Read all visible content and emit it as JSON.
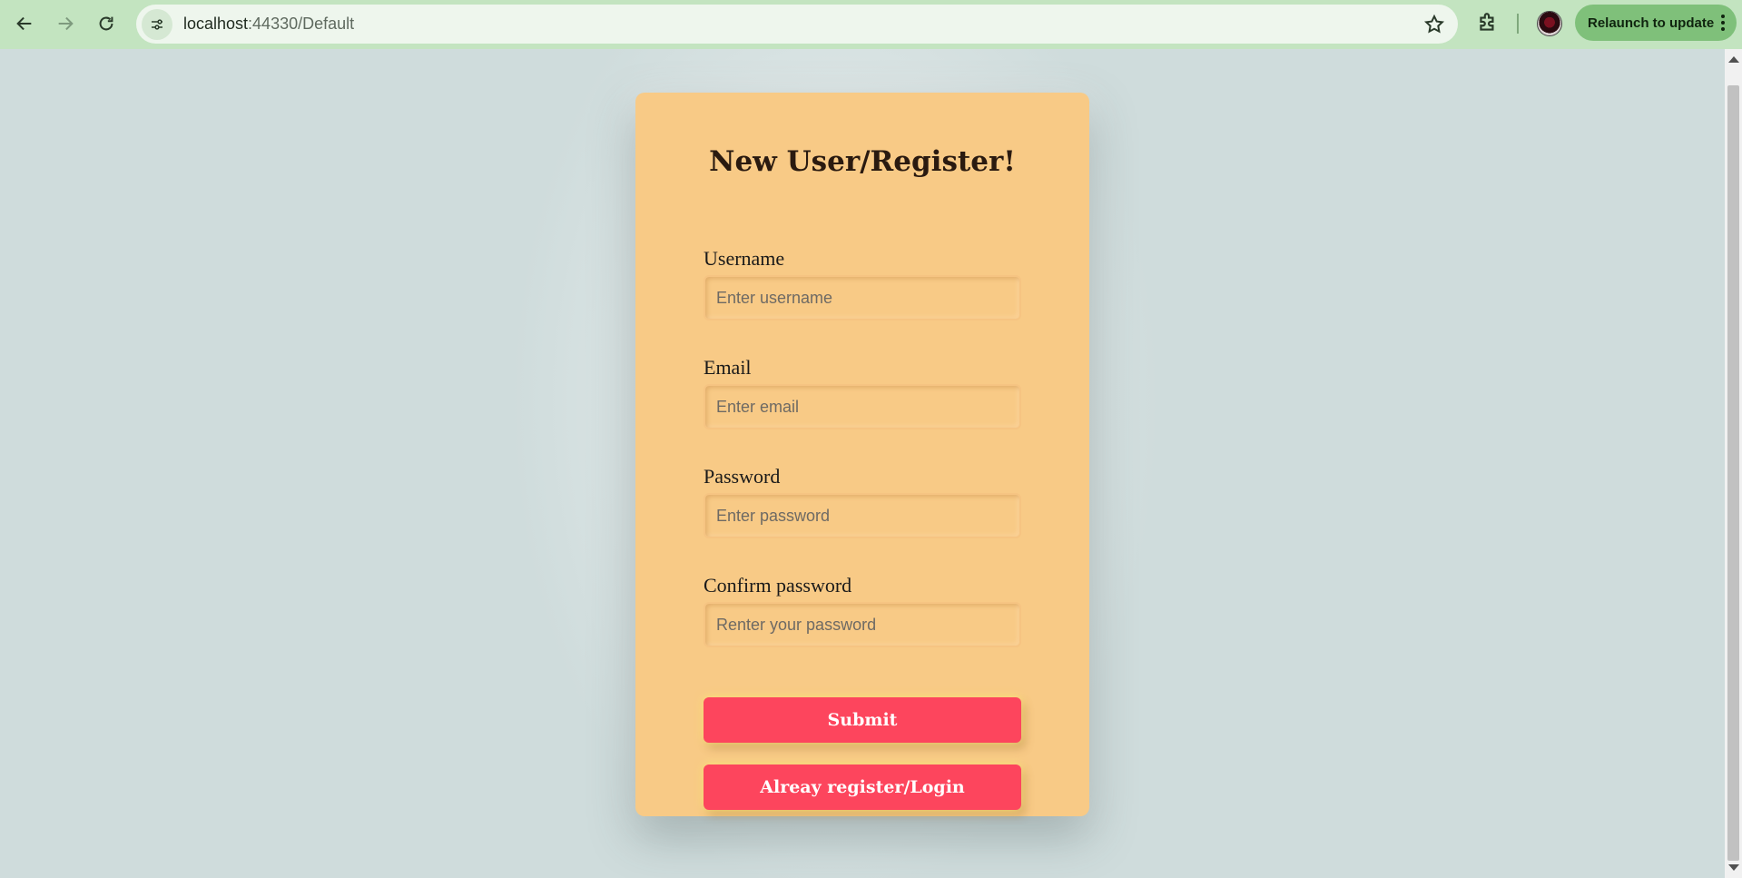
{
  "browser": {
    "url_host": "localhost",
    "url_rest": ":44330/Default",
    "relaunch_label": "Relaunch to update"
  },
  "form": {
    "title": "New User/Register!",
    "fields": [
      {
        "label": "Username",
        "placeholder": "Enter username"
      },
      {
        "label": "Email",
        "placeholder": "Enter email"
      },
      {
        "label": "Password",
        "placeholder": "Enter password"
      },
      {
        "label": "Confirm password",
        "placeholder": "Renter your password"
      }
    ],
    "submit_label": "Submit",
    "login_label": "Alreay register/Login"
  },
  "colors": {
    "page_background": "#cfdcdc",
    "card_background": "#f8ca86",
    "button_background": "#fd455d",
    "chrome_background": "#c3e4c0"
  }
}
